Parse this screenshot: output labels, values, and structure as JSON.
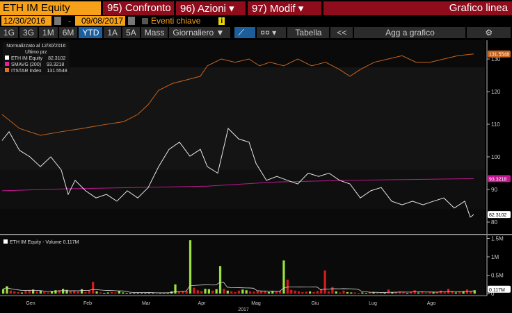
{
  "header": {
    "ticker": "ETH IM Equity",
    "menus": [
      {
        "num": "95)",
        "label": "Confronto",
        "caret": ""
      },
      {
        "num": "96)",
        "label": "Azioni",
        "caret": "▾"
      },
      {
        "num": "97)",
        "label": "Modif",
        "caret": "▾"
      }
    ],
    "chart_type": "Grafico linea"
  },
  "dates": {
    "start": "12/30/2016",
    "sep": "-",
    "end": "09/08/2017",
    "events": "Eventi chiave",
    "info": "i"
  },
  "toolbar": {
    "ranges": [
      "1G",
      "3G",
      "1M",
      "6M",
      "YTD",
      "1A",
      "5A",
      "Mass"
    ],
    "active": "YTD",
    "frequency": "Giornaliero ▼",
    "table": "Tabella",
    "collapse": "<<",
    "add": "Agg a grafico",
    "settings": "⚙"
  },
  "legend": {
    "title": "Normalizzato al 12/30/2016",
    "subtitle": "Ultimo prz",
    "items": [
      {
        "name": "ETH IM Equity",
        "value": "82.3102",
        "color": "#ffffff"
      },
      {
        "name": "SMAVG (200)",
        "value": "93.3218",
        "color": "#e020a0"
      },
      {
        "name": "ITSTAR Index",
        "value": "131.5548",
        "color": "#e07020"
      }
    ]
  },
  "volume_legend": "ETH IM Equity - Volume 0.117M",
  "chart_data": {
    "type": "line",
    "price_axis": {
      "ticks": [
        "80",
        "90",
        "100",
        "110",
        "120",
        "130"
      ],
      "ylim": [
        78,
        133
      ]
    },
    "x_months": [
      "Gen",
      "Feb",
      "Mar",
      "Apr",
      "Mag",
      "Giu",
      "Lug",
      "Ago"
    ],
    "year": "2017",
    "series": [
      {
        "name": "ITSTAR Index",
        "color": "#c8641e",
        "last": "131.5548",
        "x": [
          0,
          25,
          55,
          85,
          115,
          145,
          175,
          195,
          210,
          225,
          245,
          265,
          285,
          295,
          315,
          335,
          355,
          370,
          385,
          405,
          425,
          445,
          465,
          485,
          500,
          515,
          535,
          555,
          575,
          595,
          615,
          635,
          655,
          678
        ],
        "y": [
          113,
          108.7,
          106.6,
          107.7,
          108.7,
          109.8,
          110.8,
          113,
          116,
          120.4,
          122.5,
          123.6,
          124.7,
          127.9,
          130,
          129,
          130,
          127.9,
          129,
          127.9,
          130,
          127.9,
          129,
          126.8,
          124.7,
          126.8,
          129,
          130,
          131,
          129,
          129,
          130,
          131,
          131.55
        ]
      },
      {
        "name": "SMAVG (200)",
        "color": "#c01890",
        "last": "93.3218",
        "x": [
          0,
          95,
          195,
          295,
          395,
          495,
          678
        ],
        "y": [
          89.6,
          90.2,
          90.6,
          91,
          92.3,
          92.8,
          93.32
        ]
      },
      {
        "name": "ETH IM Equity",
        "color": "#e8e8e8",
        "last": "82.3102",
        "x": [
          0,
          10,
          25,
          40,
          55,
          70,
          85,
          95,
          105,
          120,
          135,
          150,
          165,
          180,
          195,
          210,
          225,
          240,
          255,
          270,
          285,
          295,
          310,
          325,
          340,
          355,
          365,
          380,
          395,
          410,
          425,
          440,
          455,
          470,
          485,
          500,
          515,
          530,
          545,
          560,
          575,
          590,
          605,
          620,
          635,
          650,
          665,
          673,
          678
        ],
        "y": [
          105,
          107.7,
          102,
          100,
          97,
          100,
          96,
          88.5,
          92.8,
          89.6,
          87.4,
          88.5,
          86.4,
          89.6,
          87.4,
          90.6,
          97,
          102.3,
          104.5,
          100.2,
          102.3,
          97,
          95,
          108.7,
          105.5,
          104.5,
          98,
          92.8,
          94,
          92.8,
          91.7,
          95,
          94,
          95,
          92.8,
          91.7,
          87.4,
          89.6,
          90.6,
          86.4,
          85.3,
          86.4,
          85.3,
          86.4,
          87.4,
          84.3,
          86.4,
          81.5,
          82.31
        ]
      }
    ],
    "volume": {
      "axis_ticks": [
        "0",
        "0.5M",
        "1M",
        "1.5M"
      ],
      "last": "0.117M",
      "ylim_k": [
        0,
        1500
      ],
      "bars_k": [
        120,
        200,
        -80,
        -60,
        -40,
        30,
        -70,
        -100,
        110,
        -60,
        80,
        -40,
        -30,
        60,
        90,
        -90,
        130,
        100,
        -80,
        -70,
        -60,
        120,
        -40,
        -90,
        -320,
        60,
        -30,
        20,
        30,
        -40,
        -30,
        70,
        30,
        20,
        20,
        20,
        20,
        20,
        20,
        20,
        20,
        -20,
        20,
        20,
        30,
        60,
        250,
        -60,
        -70,
        -80,
        1450,
        -160,
        -90,
        -70,
        130,
        120,
        -80,
        120,
        750,
        -130,
        80,
        -60,
        -40,
        -80,
        110,
        90,
        -60,
        -50,
        -80,
        -70,
        -60,
        40,
        60,
        -50,
        -70,
        900,
        -380,
        -100,
        -80,
        -60,
        -40,
        -50,
        60,
        -40,
        -70,
        -120,
        -630,
        -60,
        -180,
        60,
        -30,
        -80,
        40,
        30,
        -30,
        -20,
        30,
        20,
        -30,
        40,
        -20,
        -30,
        20,
        -110,
        30,
        -40,
        -60,
        -30,
        20,
        -40,
        -90,
        30,
        -50,
        -20,
        -40,
        30,
        -40,
        -80,
        -50,
        -130,
        -70,
        30,
        -40,
        60,
        -110,
        -70,
        90
      ]
    }
  }
}
